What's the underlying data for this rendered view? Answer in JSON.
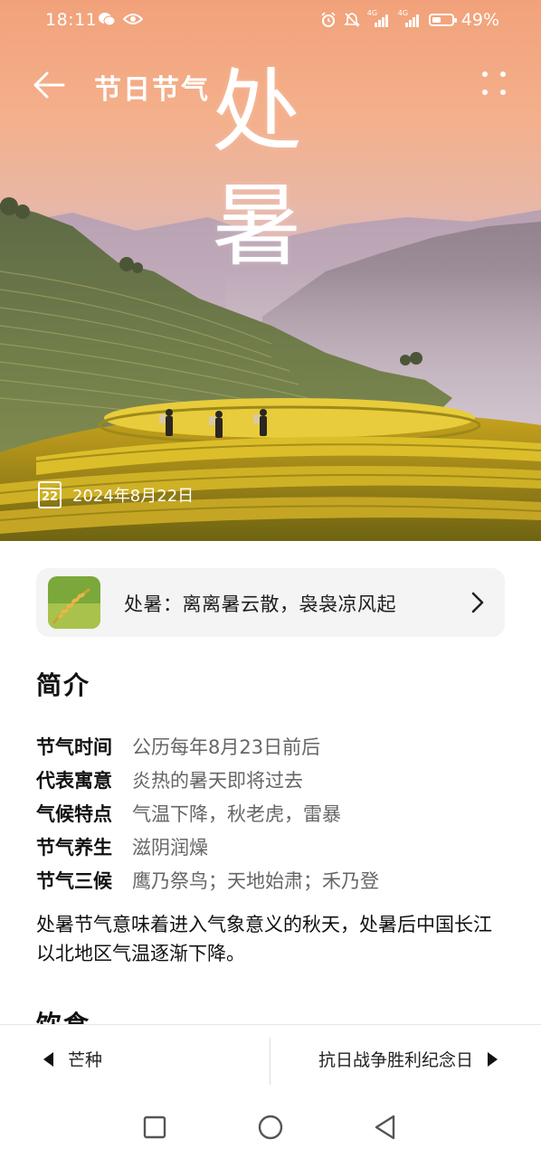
{
  "status_bar": {
    "time": "18:11",
    "battery_text": "49%",
    "battery_level": 0.49,
    "network_1": "4G",
    "network_2": "4G"
  },
  "header": {
    "title": "节日节气",
    "term_char_1": "处",
    "term_char_2": "暑",
    "date": "2024年8月22日",
    "calendar_day": "22"
  },
  "banner": {
    "text": "处暑：离离暑云散，袅袅凉风起"
  },
  "intro": {
    "title": "简介",
    "items": [
      {
        "label": "节气时间",
        "value": "公历每年8月23日前后"
      },
      {
        "label": "代表寓意",
        "value": "炎热的暑天即将过去"
      },
      {
        "label": "气候特点",
        "value": "气温下降，秋老虎，雷暴"
      },
      {
        "label": "节气养生",
        "value": "滋阴润燥"
      },
      {
        "label": "节气三候",
        "value": "鹰乃祭鸟；天地始肃；禾乃登"
      }
    ],
    "description": "处暑节气意味着进入气象意义的秋天，处暑后中国长江以北地区气温逐渐下降。",
    "next_section_title": "饮食"
  },
  "bottom_nav": {
    "prev_label": "芒种",
    "next_label": "抗日战争胜利纪念日"
  },
  "colors": {
    "sky_top": "#f2a27a",
    "rice_gold": "#d9b21c",
    "banner_bg": "#f4f4f4",
    "value_gray": "#666666"
  }
}
